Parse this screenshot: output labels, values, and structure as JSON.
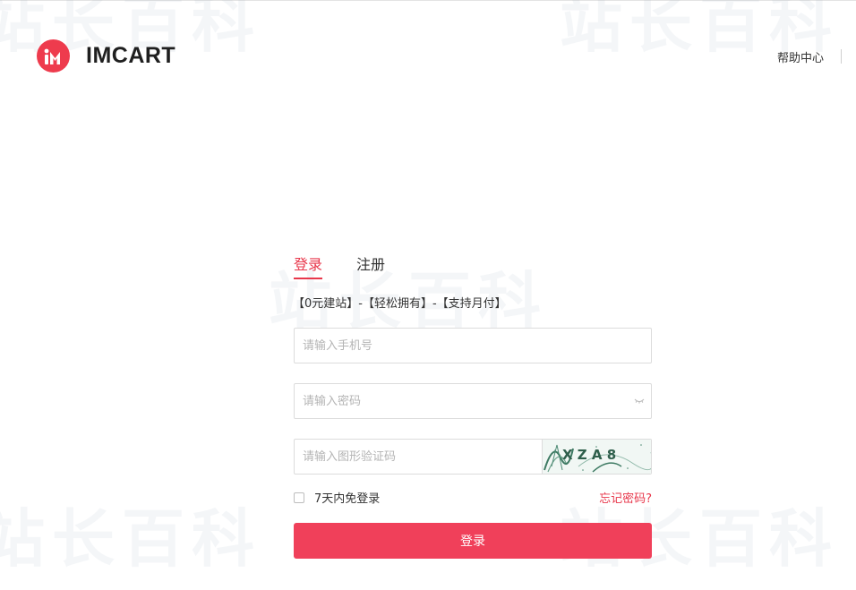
{
  "brand": {
    "name": "IMCART",
    "logo_icon": "imcart-logo-icon",
    "accent_color": "#ee3b4d"
  },
  "header": {
    "help_label": "帮助中心"
  },
  "watermark": {
    "text": "站长百科"
  },
  "login": {
    "tabs": [
      {
        "label": "登录",
        "active": true
      },
      {
        "label": "注册",
        "active": false
      }
    ],
    "slogan": "【0元建站】-【轻松拥有】-【支持月付】",
    "phone_placeholder": "请输入手机号",
    "password_placeholder": "请输入密码",
    "captcha_placeholder": "请输入图形验证码",
    "captcha_text": "X Z A 8",
    "remember_label": "7天内免登录",
    "forgot_label": "忘记密码?",
    "submit_label": "登录",
    "submit_color": "#f0405a"
  }
}
